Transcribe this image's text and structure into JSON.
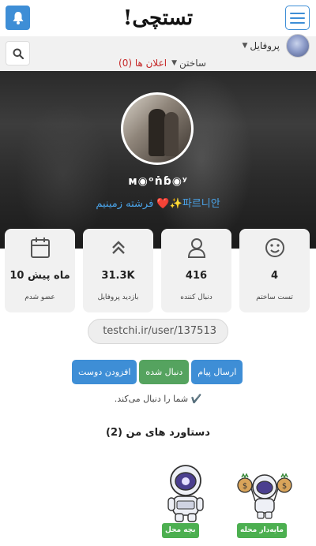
{
  "header": {
    "logo_text": "تستچی!",
    "bell_icon": "bell-icon",
    "menu_icon": "hamburger-icon"
  },
  "nav": {
    "profile_label": "پروفایل",
    "build_label": "ساختن",
    "ads_label": "اعلان ها (0)",
    "search_icon": "search-icon"
  },
  "profile": {
    "username": "ᴍ◉ᵒṅɓ◉ʸ",
    "bio": "파르니안✨❤️ فرشته زمینیم"
  },
  "stats": [
    {
      "icon": "calendar-icon",
      "value": "10 ماه پیش",
      "label": "عضو شدم"
    },
    {
      "icon": "chevrons-up-icon",
      "value": "31.3K",
      "label": "بازدید پروفایل"
    },
    {
      "icon": "user-icon",
      "value": "416",
      "label": "دنبال کننده"
    },
    {
      "icon": "smile-icon",
      "value": "4",
      "label": "تست ساختم"
    }
  ],
  "profile_url": "testchi.ir/user/137513",
  "actions": {
    "add_friend": "افزودن دوست",
    "following": "دنبال شده",
    "send_message": "ارسال پیام"
  },
  "follows_you_text": "✔️ شما را دنبال می‌کند.",
  "achievements": {
    "title": "دستاورد های من (2)",
    "items": [
      {
        "label": "بچه محل",
        "icon": "astronaut-icon"
      },
      {
        "label": "مایه‌دار محله",
        "icon": "rich-astronaut-icon"
      }
    ]
  },
  "colors": {
    "accent_blue": "#3e8ed6",
    "green": "#55a35f",
    "ads_red": "#c62828",
    "bio_blue": "#4aa3e8"
  }
}
